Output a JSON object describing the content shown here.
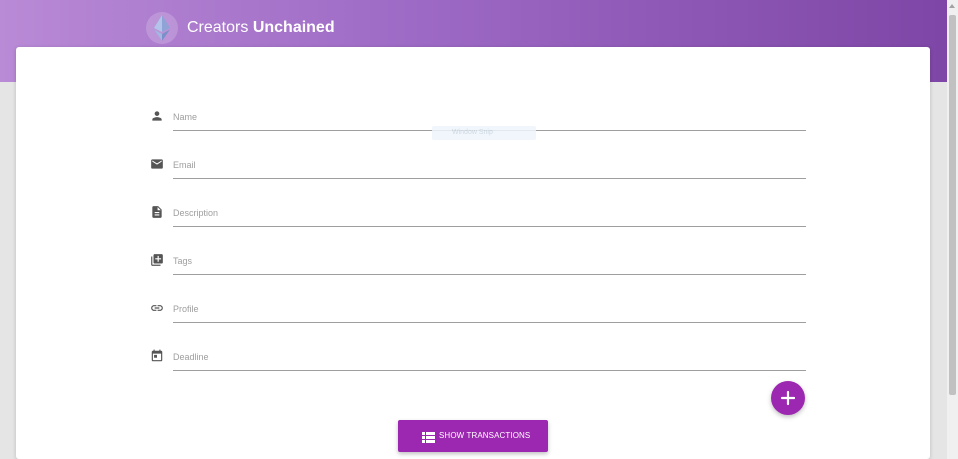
{
  "header": {
    "brand_light": "Creators",
    "brand_bold": "Unchained",
    "logo_icon": "ethereum-icon"
  },
  "form": {
    "fields": [
      {
        "name": "name-field",
        "icon": "person-icon",
        "placeholder": "Name"
      },
      {
        "name": "email-field",
        "icon": "email-icon",
        "placeholder": "Email"
      },
      {
        "name": "description-field",
        "icon": "description-icon",
        "placeholder": "Description"
      },
      {
        "name": "tags-field",
        "icon": "add-to-library-icon",
        "placeholder": "Tags"
      },
      {
        "name": "profile-field",
        "icon": "link-icon",
        "placeholder": "Profile"
      },
      {
        "name": "deadline-field",
        "icon": "calendar-icon",
        "placeholder": "Deadline"
      }
    ],
    "add_button_icon": "plus-icon"
  },
  "tooltip": {
    "label": "Window Snip"
  },
  "actions": {
    "show_transactions_label": "SHOW TRANSACTIONS",
    "show_transactions_icon": "table-icon"
  },
  "colors": {
    "accent": "#9c27b0",
    "header_start": "#b98ad6",
    "header_end": "#7e46a6"
  }
}
